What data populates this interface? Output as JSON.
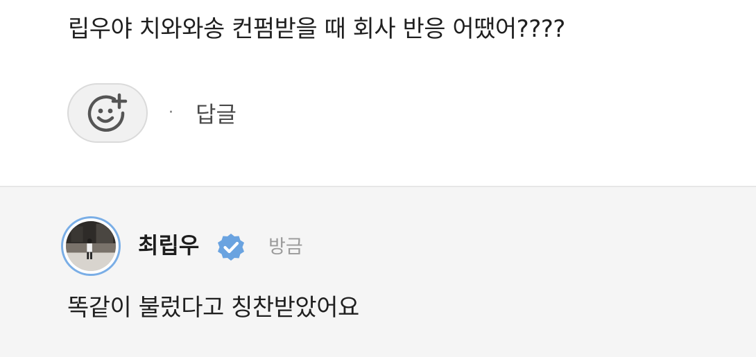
{
  "question": {
    "text": "립우야 치와와송 컨펌받을 때 회사 반응 어땠어????"
  },
  "actions": {
    "reaction_icon": "add-emoji-icon",
    "separator": "·",
    "reply_label": "답글"
  },
  "reply": {
    "author_name": "최립우",
    "verified_icon": "verified-check-icon",
    "timestamp": "방금",
    "text": "똑같이 불렀다고 칭찬받았어요"
  },
  "colors": {
    "verified": "#6aa3e0",
    "avatar_ring": "#7aaee6",
    "reply_background": "#f5f5f5",
    "icon_stroke": "#555555"
  }
}
